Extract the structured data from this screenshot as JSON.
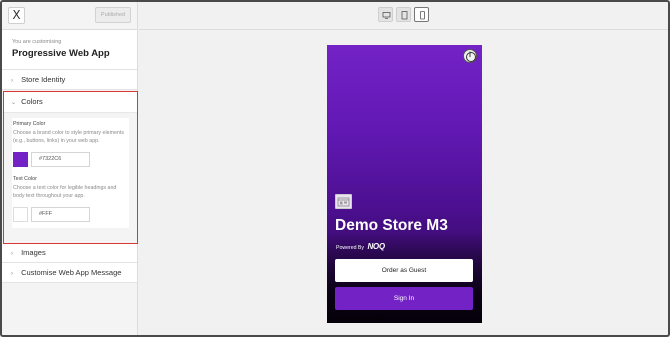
{
  "header": {
    "close_label": "X",
    "publish_label": "Published"
  },
  "customising": {
    "subtitle": "You are customising",
    "title": "Progressive Web App"
  },
  "sections": {
    "store_identity": "Store Identity",
    "colors": "Colors",
    "images": "Images",
    "web_app_message": "Customise Web App Message"
  },
  "colors": {
    "primary": {
      "label": "Primary Color",
      "description": "Choose a brand color to style primary elements (e.g., buttons, links) in your web app.",
      "value": "#7322C6",
      "swatch": "#7322c6"
    },
    "text": {
      "label": "Text Color",
      "description": "Choose a text color for legible headings and body text throughout your app.",
      "value": "#FFF",
      "swatch": "#ffffff"
    },
    "highlight_border": "#d93636"
  },
  "preview": {
    "devices": [
      "desktop-icon",
      "tablet-icon",
      "mobile-icon"
    ],
    "active_device": "mobile",
    "store_name": "Demo Store M3",
    "powered_by": "Powered By",
    "powered_logo": "NOQ",
    "guest_button": "Order as Guest",
    "signin_button": "Sign In"
  }
}
